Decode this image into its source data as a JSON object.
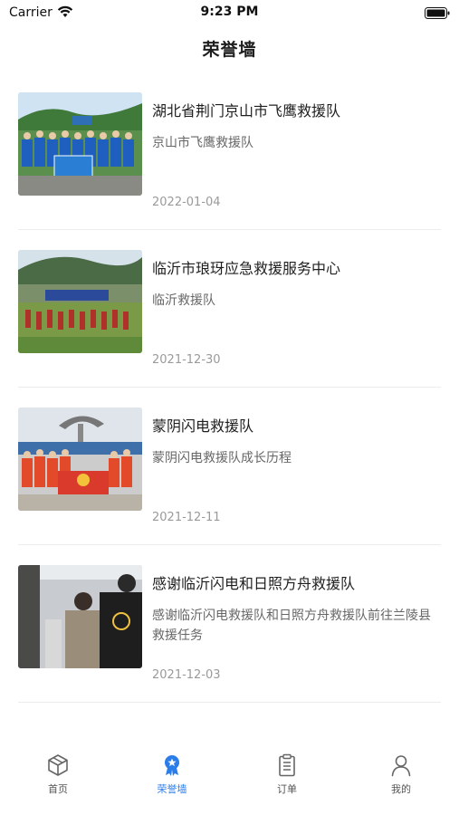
{
  "status_bar": {
    "carrier": "Carrier",
    "time": "9:23 PM",
    "icons": [
      "wifi-icon",
      "battery-icon"
    ]
  },
  "nav": {
    "title": "荣誉墙"
  },
  "honor_list": [
    {
      "title": "湖北省荆门京山市飞鹰救援队",
      "description": "京山市飞鹰救援队",
      "date": "2022-01-04"
    },
    {
      "title": "临沂市琅玡应急救援服务中心",
      "description": "临沂救援队",
      "date": "2021-12-30"
    },
    {
      "title": "蒙阴闪电救援队",
      "description": "蒙阴闪电救援队成长历程",
      "date": "2021-12-11"
    },
    {
      "title": "感谢临沂闪电和日照方舟救援队",
      "description": "感谢临沂闪电救援队和日照方舟救援队前往兰陵县救援任务",
      "date": "2021-12-03"
    }
  ],
  "tabbar": {
    "active": "荣誉墙",
    "active_color": "#2b7de9",
    "tabs": [
      {
        "label": "首页",
        "icon": "cube-icon"
      },
      {
        "label": "荣誉墙",
        "icon": "badge-icon"
      },
      {
        "label": "订单",
        "icon": "clipboard-icon"
      },
      {
        "label": "我的",
        "icon": "user-icon"
      }
    ]
  }
}
